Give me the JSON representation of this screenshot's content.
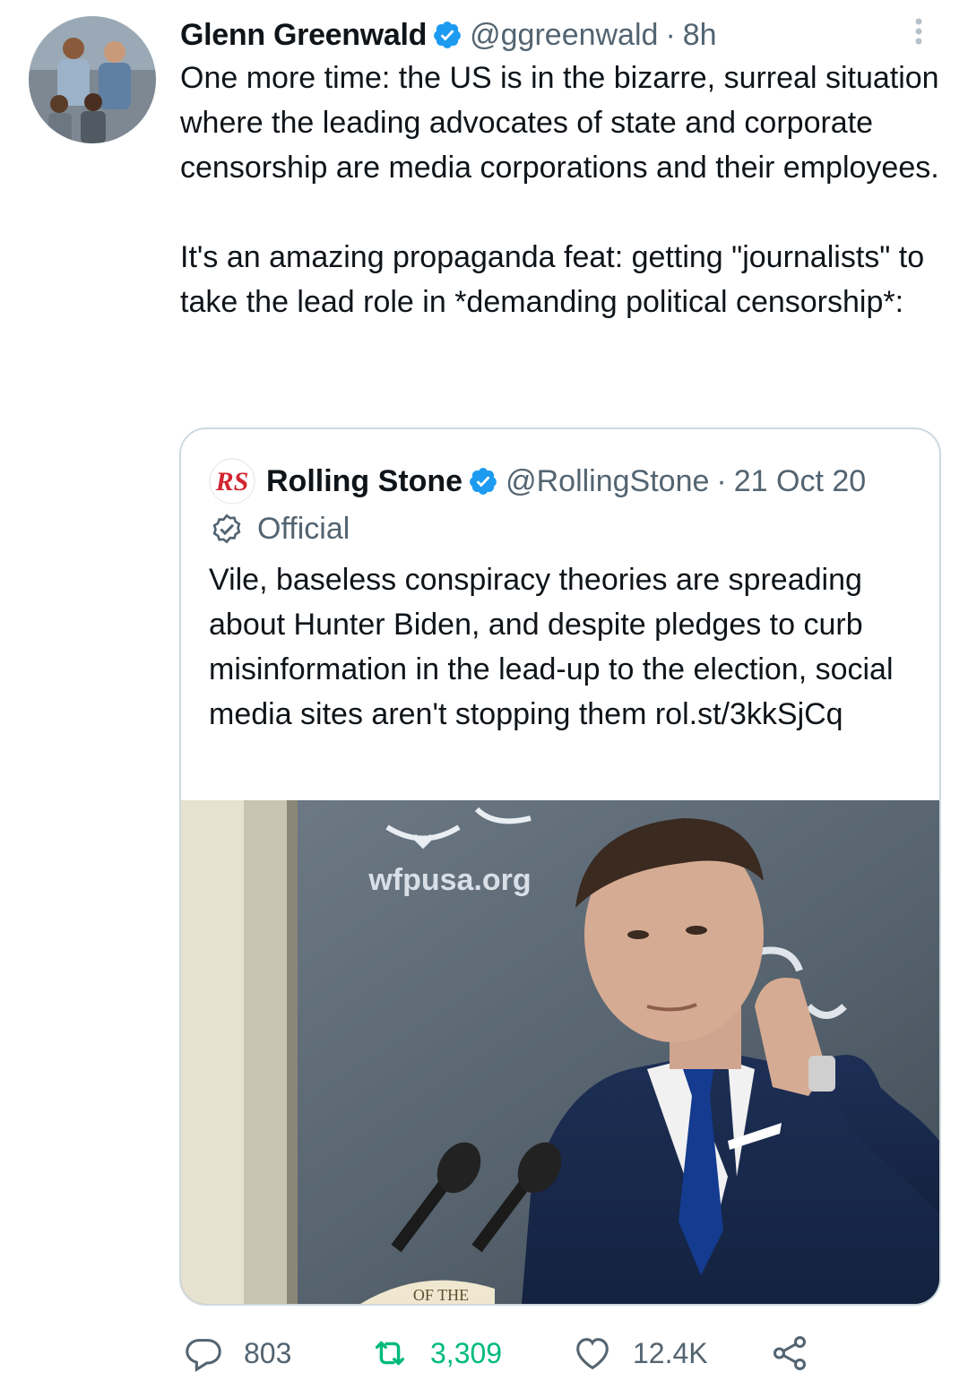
{
  "tweet": {
    "author": {
      "name": "Glenn Greenwald",
      "handle": "@ggreenwald",
      "separator": "·",
      "time": "8h",
      "avatar_icon": "profile-photo-avatar",
      "verified_icon": "verified-badge-icon"
    },
    "text": {
      "paragraph_1": "One more time: the US is in the bizarre, surreal situation where the leading advocates of state and corporate censorship are media corporations and their employees.",
      "paragraph_2": "It's an amazing propaganda feat: getting \"journalists\" to take the lead role in *demanding political censorship*:"
    },
    "more_icon": "more-options-icon"
  },
  "quoted_tweet": {
    "author": {
      "name": "Rolling Stone",
      "handle": "@RollingStone",
      "separator": "·",
      "time": "21 Oct 20",
      "logo_text": "RS",
      "logo_icon": "rolling-stone-logo"
    },
    "label": "Official",
    "label_icon": "official-badge-icon",
    "text": "Vile, baseless conspiracy theories are spreading about Hunter Biden, and despite pledges to curb misinformation in the lead-up to the election, social media sites aren't stopping them rol.st/3kkSjCq",
    "image": {
      "backdrop_text": "wfpusa.org",
      "podium_text": "OF THE"
    }
  },
  "actions": {
    "reply": {
      "icon": "reply-icon",
      "count": "803"
    },
    "retweet": {
      "icon": "retweet-icon",
      "count": "3,309"
    },
    "like": {
      "icon": "like-icon",
      "count": "12.4K"
    },
    "share": {
      "icon": "share-icon"
    }
  },
  "colors": {
    "text_primary": "#0f1419",
    "text_secondary": "#536471",
    "verified_blue": "#1d9bf0",
    "retweet_green": "#00ba7c",
    "border": "#cfd9de",
    "rs_red": "#d32531"
  }
}
